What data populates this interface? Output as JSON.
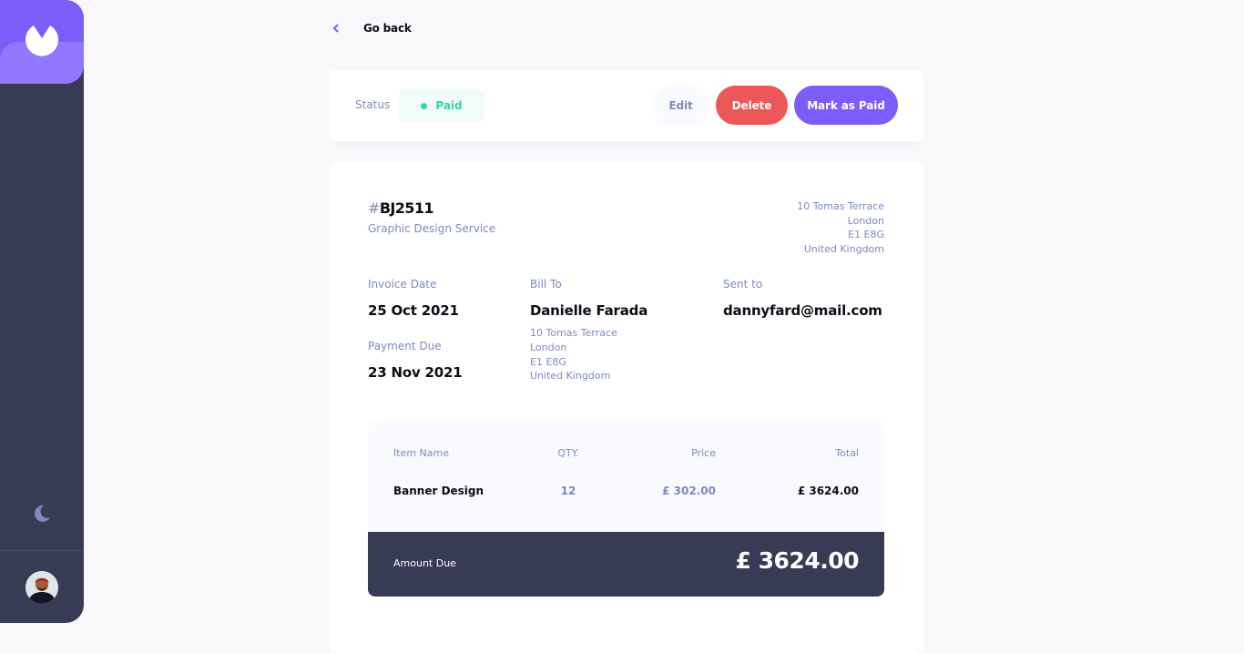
{
  "colors": {
    "sidebar": "#373b53",
    "logo": "#7c5dfa",
    "accent": "#7c5dfa",
    "paid_status": "#33d69f",
    "delete": "#ec5757",
    "muted_text": "#7e88c3"
  },
  "sidebar": {
    "logo_icon": "logo-icon",
    "theme_icon": "moon-icon",
    "avatar_icon": "user-avatar"
  },
  "nav": {
    "go_back_label": "Go back"
  },
  "status_bar": {
    "status_label": "Status",
    "status_value": "Paid",
    "edit_label": "Edit",
    "delete_label": "Delete",
    "mark_paid_label": "Mark as Paid"
  },
  "invoice": {
    "hash": "#",
    "id": "BJ2511",
    "description": "Graphic Design Service",
    "sender_address": [
      "10 Tomas Terrace",
      "London",
      "E1 E8G",
      "United Kingdom"
    ],
    "invoice_date_label": "Invoice Date",
    "invoice_date": "25 Oct 2021",
    "payment_due_label": "Payment Due",
    "payment_due": "23 Nov 2021",
    "bill_to_label": "Bill To",
    "client_name": "Danielle Farada",
    "client_address": [
      "10 Tomas Terrace",
      "London",
      "E1 E8G",
      "United Kingdom"
    ],
    "sent_to_label": "Sent to",
    "client_email": "dannyfard@mail.com"
  },
  "items_table": {
    "headers": [
      "Item Name",
      "QTY.",
      "Price",
      "Total"
    ],
    "rows": [
      {
        "name": "Banner Design",
        "qty": "12",
        "price": "£ 302.00",
        "total": "£ 3624.00"
      }
    ],
    "amount_due_label": "Amount Due",
    "amount_due_value": "£ 3624.00"
  }
}
